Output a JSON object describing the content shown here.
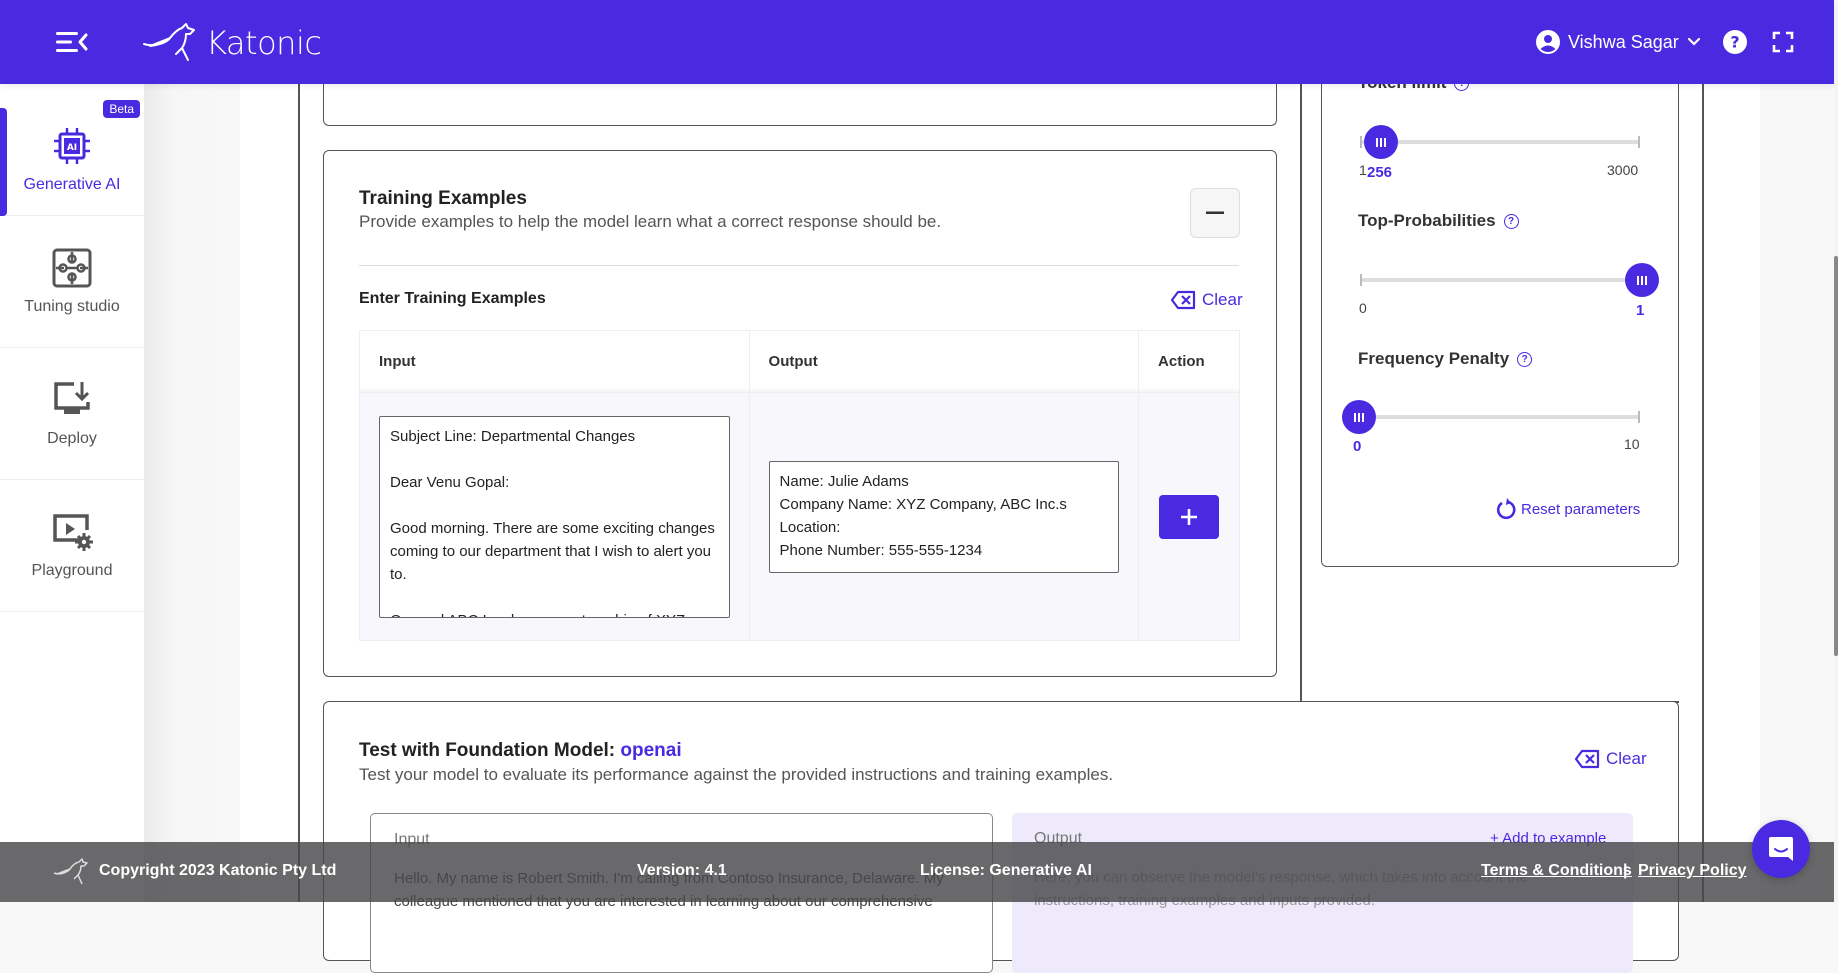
{
  "header": {
    "brand": "Katonic",
    "user_name": "Vishwa Sagar",
    "accent_color": "#4a2ae0"
  },
  "sidebar": {
    "items": [
      {
        "label": "Generative AI",
        "icon": "ai-chip-icon",
        "badge": "Beta",
        "active": true
      },
      {
        "label": "Tuning studio",
        "icon": "puzzle-icon"
      },
      {
        "label": "Deploy",
        "icon": "monitor-download-icon"
      },
      {
        "label": "Playground",
        "icon": "play-settings-icon"
      }
    ]
  },
  "training": {
    "title": "Training Examples",
    "subtitle": "Provide examples to help the model learn what a correct response should be.",
    "enter_label": "Enter Training Examples",
    "clear_label": "Clear",
    "columns": [
      "Input",
      "Output",
      "Action"
    ],
    "rows": [
      {
        "input": "Subject Line: Departmental Changes\n\nDear Venu Gopal:\n\nGood morning. There are some exciting changes coming to our department that I wish to alert you to.\n\nOur and ABC Inc. have a partnership of XYZ...",
        "output": "Name: Julie Adams\nCompany Name: XYZ Company, ABC Inc.s\nLocation:\nPhone Number: 555-555-1234"
      }
    ]
  },
  "params": {
    "token_limit": {
      "label": "Token limit",
      "min": "1",
      "max": "3000",
      "value": "256",
      "fraction": 0.085
    },
    "top_p": {
      "label": "Top-Probabilities",
      "min": "0",
      "max": "",
      "value": "1",
      "fraction": 1.0
    },
    "frequency_penalty": {
      "label": "Frequency Penalty",
      "min": "",
      "max": "10",
      "value": "0",
      "fraction": 0.0
    },
    "reset_label": "Reset parameters"
  },
  "test": {
    "title": "Test with Foundation Model:",
    "model": "openai",
    "subtitle": "Test your model to evaluate its performance against the provided instructions and training examples.",
    "clear_label": "Clear",
    "input_label": "Input",
    "input_text": "Hello. My name is Robert Smith. I'm calling from Contoso Insurance, Delaware. My colleague mentioned that you are interested in learning about our comprehensive",
    "output_label": "Output",
    "add_to_example": "+ Add to example",
    "output_placeholder": "Here, you can observe the model's response, which takes into account the instructions, training examples and inputs provided."
  },
  "footer": {
    "copyright": "Copyright 2023 Katonic Pty Ltd",
    "version": "Version: 4.1",
    "license": "License: Generative AI",
    "terms": "Terms & Conditions",
    "separator": "|",
    "privacy": "Privacy Policy"
  }
}
